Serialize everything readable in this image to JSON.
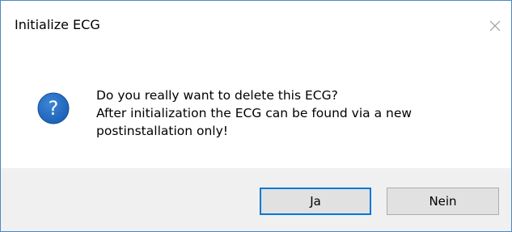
{
  "window": {
    "title": "Initialize ECG",
    "close_icon": "close-icon"
  },
  "message": {
    "icon": "question-icon",
    "icon_glyph": "?",
    "line1": "Do you really want to delete this ECG?",
    "line2": "After initialization the ECG can be found via a new",
    "line3": "postinstallation only!"
  },
  "buttons": {
    "yes_label": "Ja",
    "no_label": "Nein"
  },
  "colors": {
    "window_border": "#4a8ac9",
    "icon_fill": "#1a5fb4",
    "button_bar": "#f0f0f0",
    "default_button_border": "#0078d7"
  }
}
